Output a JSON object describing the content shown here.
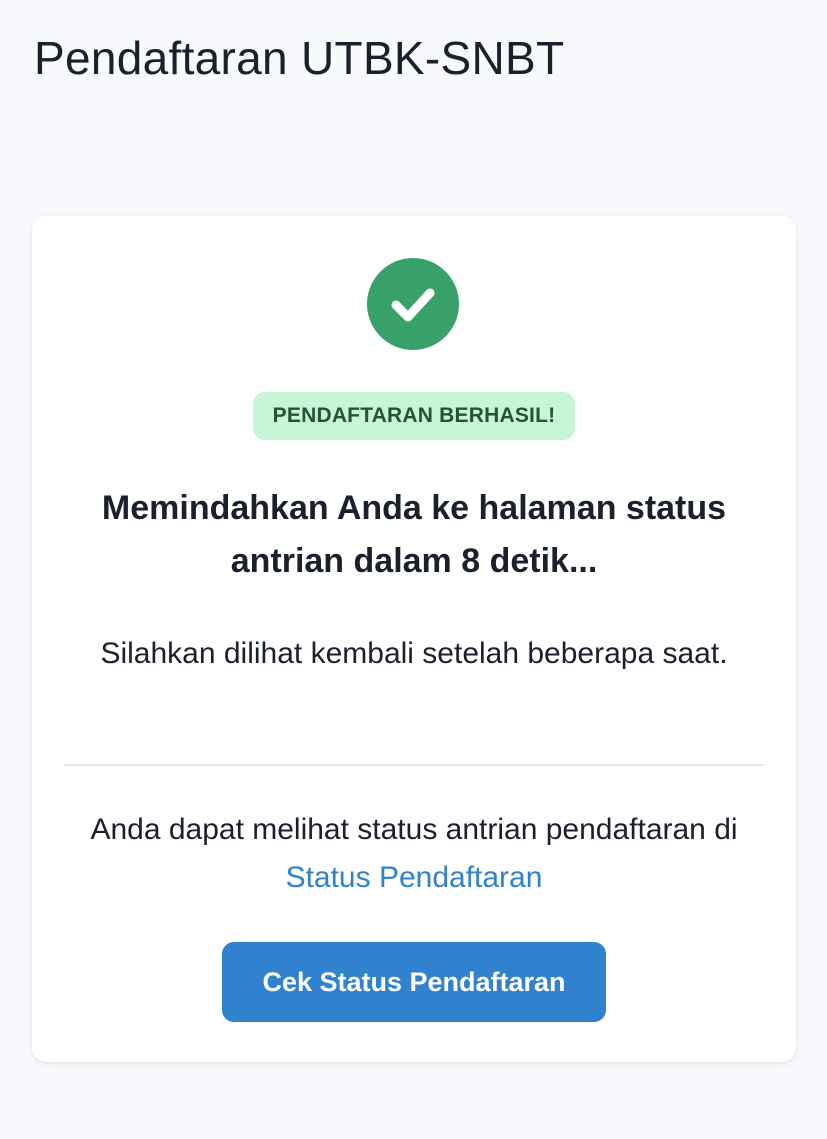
{
  "header": {
    "title": "Pendaftaran UTBK-SNBT"
  },
  "card": {
    "success_icon": "check-circle-icon",
    "badge_label": "PENDAFTARAN BERHASIL!",
    "heading": "Memindahkan Anda ke halaman status antrian dalam 8 detik...",
    "subtext": "Silahkan dilihat kembali setelah beberapa saat.",
    "info_text_prefix": "Anda dapat melihat status antrian pendaftaran di",
    "info_link_label": "Status Pendaftaran",
    "button_label": "Cek Status Pendaftaran"
  },
  "colors": {
    "success": "#38a169",
    "badge_bg": "#c6f6d5",
    "badge_text": "#22543d",
    "primary": "#3182ce",
    "background": "#f8f9fc"
  }
}
